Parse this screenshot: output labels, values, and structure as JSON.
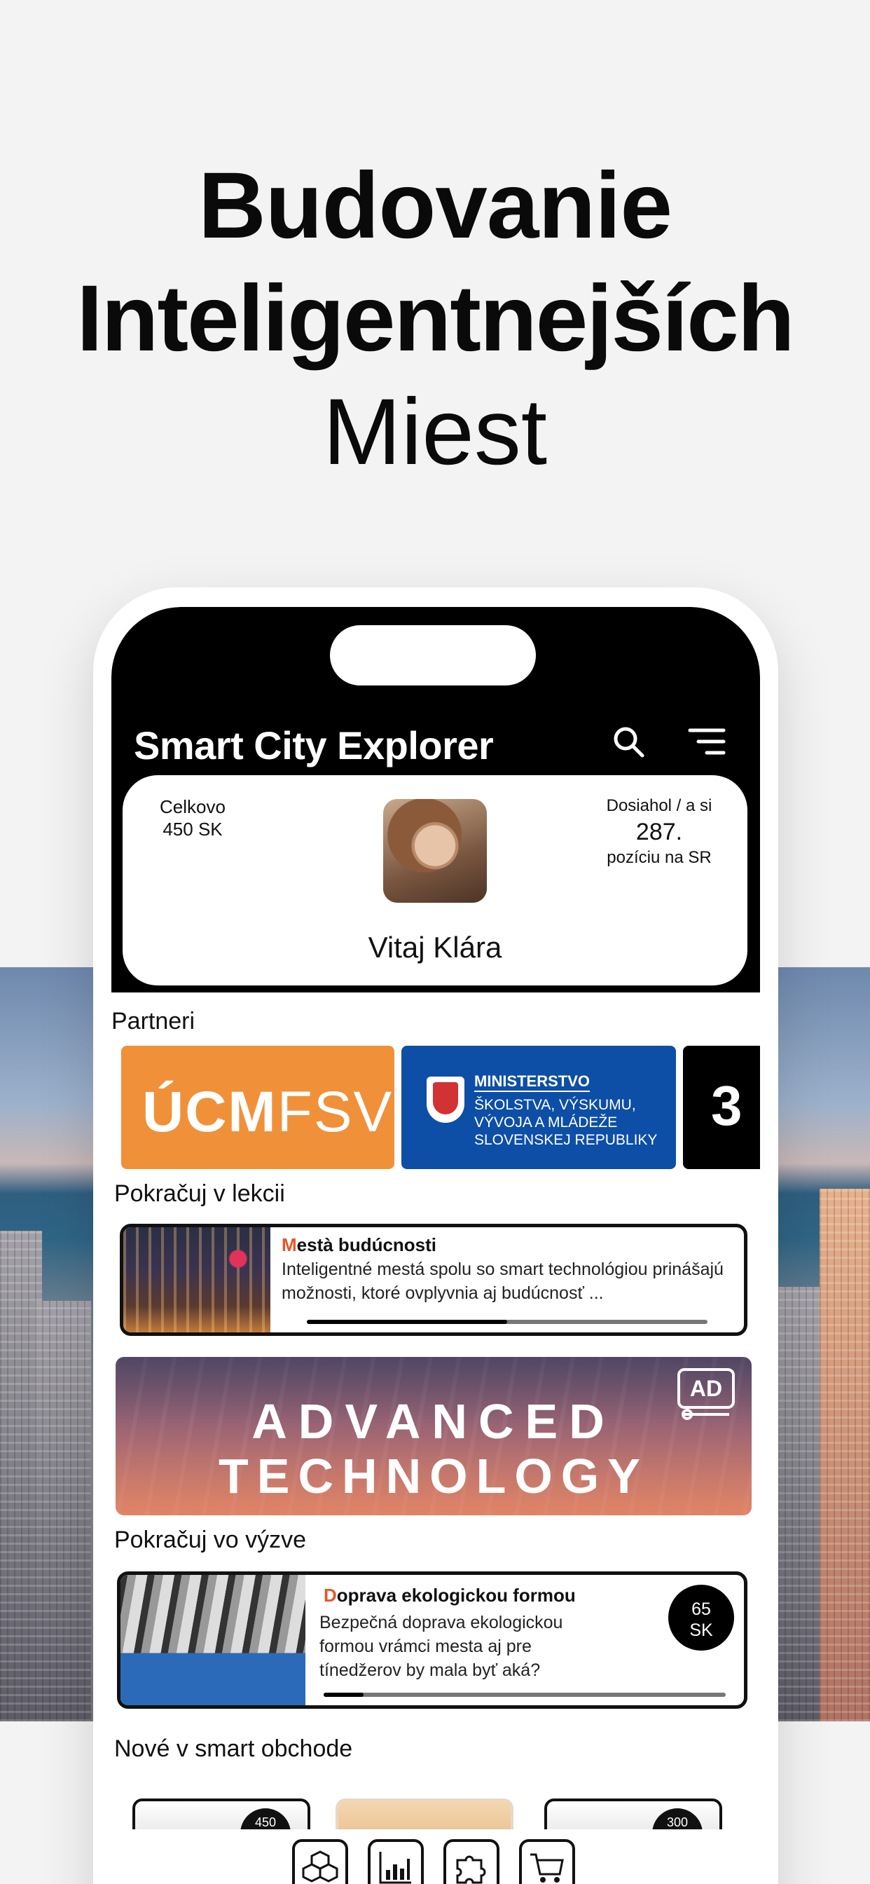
{
  "headline": {
    "line1": "Budovanie",
    "line2": "Inteligentnejších",
    "line3": "Miest"
  },
  "app": {
    "title": "Smart City Explorer",
    "search_icon": "search-icon",
    "menu_icon": "menu-icon"
  },
  "profile": {
    "total_label": "Celkovo",
    "total_value": "450 SK",
    "greeting": "Vitaj Klára",
    "rank_label": "Dosiahol / a si",
    "rank_value": "287.",
    "rank_sub": "pozíciu na SR"
  },
  "partners": {
    "title": "Partneri",
    "items": [
      {
        "logo_main": "ÚCM",
        "logo_thin": "FSV"
      },
      {
        "line1": "MINISTERSTVO",
        "line2": "ŠKOLSTVA, VÝSKUMU,",
        "line3": "VÝVOJA A MLÁDEŽE",
        "line4": "SLOVENSKEJ REPUBLIKY"
      },
      {
        "logo": "3"
      }
    ]
  },
  "lesson": {
    "section_title": "Pokračuj v lekcii",
    "title_first": "M",
    "title_rest": "està budúcnosti",
    "text": "Inteligentné mestá spolu so smart technológiou prinášajú možnosti, ktoré ovplyvnia aj budúcnosť ...",
    "progress": 0.5
  },
  "ad": {
    "line1": "ADVANCED",
    "line2": "TECHNOLOGY",
    "badge": "AD"
  },
  "challenge": {
    "section_title": "Pokračuj vo výzve",
    "title_first": "D",
    "title_rest": "oprava ekologickou formou",
    "text": "Bezpečná doprava ekologickou formou vrámci mesta aj pre tínedžerov by mala byť aká?",
    "reward_value": "65",
    "reward_unit": "SK",
    "progress": 0.1
  },
  "shop": {
    "section_title": "Nové v smart obchode",
    "badges": [
      "450",
      "",
      "300"
    ]
  },
  "tabs": [
    "cubes-icon",
    "chart-icon",
    "puzzle-icon",
    "cart-icon"
  ]
}
